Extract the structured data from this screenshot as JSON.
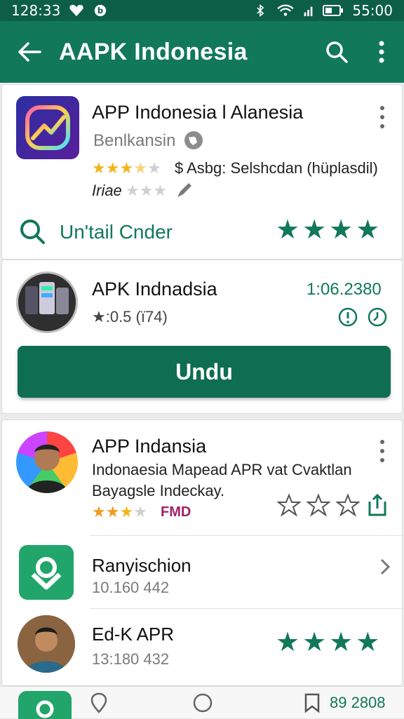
{
  "status_bar": {
    "time": "128:33",
    "clock": "55:00",
    "left_icons": [
      "heart-icon",
      "b-badge-icon"
    ],
    "right_icons": [
      "bluetooth-icon",
      "wifi-icon",
      "signal-icon",
      "battery-icon"
    ]
  },
  "app_bar": {
    "title": "AAPK Indonesia",
    "color": "#11785a",
    "actions": [
      "back-arrow-icon",
      "search-icon",
      "more-vert-icon"
    ]
  },
  "card1": {
    "title": "APP Indonesia l Alanesia",
    "developer": "Benlkansin",
    "rating_line": "$ Asbg: Selshcdan (hüplasdil)",
    "rating_stars": 3.5,
    "second_label": "Iriae",
    "second_stars": 1,
    "action_label": "Un'tail Cnder",
    "big_stars": 4
  },
  "card2": {
    "title": "APK Indnadsia",
    "rating_text": "★:0.5 (ï74)",
    "size_text": "1:06.2380",
    "button_label": "Undu"
  },
  "card3": {
    "title": "APP Indansia",
    "desc_line1": "Indonaesia Mapead APR vat Cvaktlan",
    "desc_line2": "Bayagsle Indeckay.",
    "rating_stars": 3,
    "badge": "FMD",
    "badge_color": "#a0206a",
    "items": [
      {
        "title": "Ranyischion",
        "sub": "10.160 442"
      },
      {
        "title": "Ed-K APR",
        "sub": "13:180 432"
      }
    ]
  },
  "bottom_nav": {
    "count": "89 2808"
  }
}
